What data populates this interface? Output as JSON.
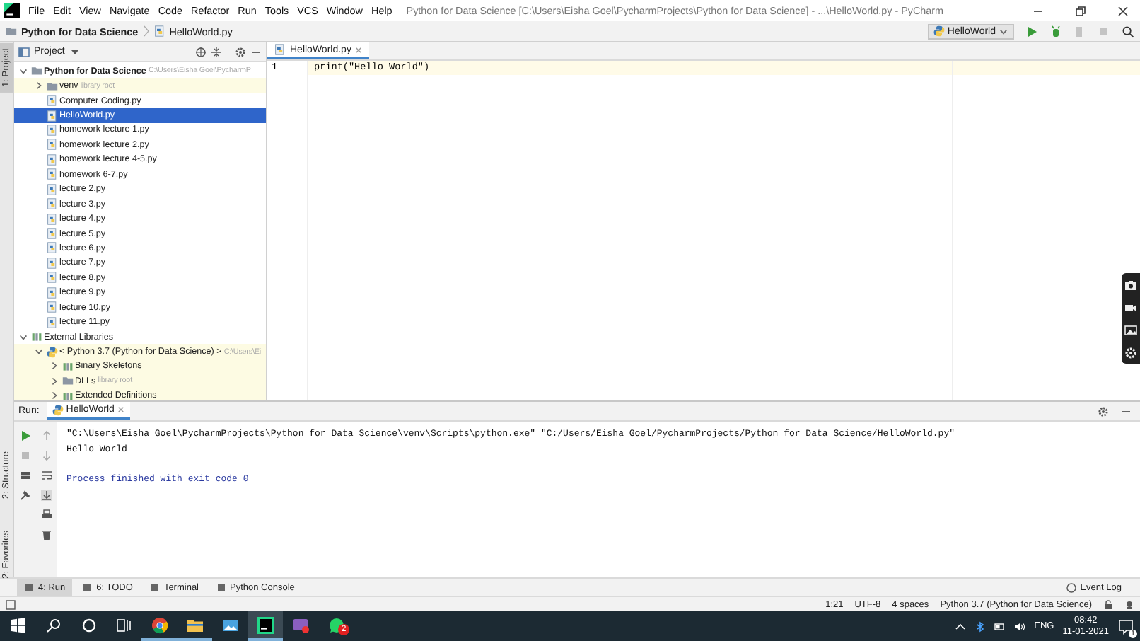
{
  "menu": [
    "File",
    "Edit",
    "View",
    "Navigate",
    "Code",
    "Refactor",
    "Run",
    "Tools",
    "VCS",
    "Window",
    "Help"
  ],
  "window": {
    "title": "Python for Data Science [C:\\Users\\Eisha Goel\\PycharmProjects\\Python for Data Science] - ...\\HelloWorld.py - PyCharm"
  },
  "breadcrumb": [
    "Python for Data Science",
    "HelloWorld.py"
  ],
  "run_config": {
    "label": "HelloWorld"
  },
  "side_tabs": [
    {
      "label": "1: Project",
      "selected": true
    },
    {
      "label": "2: Structure",
      "selected": false
    },
    {
      "label": "2: Favorites",
      "selected": false
    }
  ],
  "project_panel": {
    "title": "Project",
    "tree": [
      {
        "kind": "folder",
        "name": "Python for Data Science",
        "hint": "C:\\Users\\Eisha Goel\\PycharmP",
        "expanded": true,
        "tinted": false,
        "selected": false,
        "children": [
          {
            "kind": "folder",
            "name": "venv",
            "hint": "library root",
            "expanded": false,
            "tinted": true,
            "selected": false
          },
          {
            "kind": "file",
            "name": "Computer Coding.py",
            "tinted": false,
            "selected": false
          },
          {
            "kind": "file",
            "name": "HelloWorld.py",
            "tinted": false,
            "selected": true
          },
          {
            "kind": "file",
            "name": "homework lecture 1.py",
            "tinted": false,
            "selected": false
          },
          {
            "kind": "file",
            "name": "homework lecture 2.py",
            "tinted": false,
            "selected": false
          },
          {
            "kind": "file",
            "name": "homework lecture 4-5.py",
            "tinted": false,
            "selected": false
          },
          {
            "kind": "file",
            "name": "homework 6-7.py",
            "tinted": false,
            "selected": false
          },
          {
            "kind": "file",
            "name": "lecture 2.py",
            "tinted": false,
            "selected": false
          },
          {
            "kind": "file",
            "name": "lecture 3.py",
            "tinted": false,
            "selected": false
          },
          {
            "kind": "file",
            "name": "lecture 4.py",
            "tinted": false,
            "selected": false
          },
          {
            "kind": "file",
            "name": "lecture 5.py",
            "tinted": false,
            "selected": false
          },
          {
            "kind": "file",
            "name": "lecture 6.py",
            "tinted": false,
            "selected": false
          },
          {
            "kind": "file",
            "name": "lecture 7.py",
            "tinted": false,
            "selected": false
          },
          {
            "kind": "file",
            "name": "lecture 8.py",
            "tinted": false,
            "selected": false
          },
          {
            "kind": "file",
            "name": "lecture 9.py",
            "tinted": false,
            "selected": false
          },
          {
            "kind": "file",
            "name": "lecture 10.py",
            "tinted": false,
            "selected": false
          },
          {
            "kind": "file",
            "name": "lecture 11.py",
            "tinted": false,
            "selected": false
          }
        ]
      },
      {
        "kind": "library",
        "name": "External Libraries",
        "expanded": true,
        "tinted": false,
        "selected": false,
        "children": [
          {
            "kind": "python",
            "name": "< Python 3.7 (Python for Data Science) >",
            "hint": "C:\\Users\\Ei",
            "expanded": true,
            "tinted": true,
            "selected": false,
            "children": [
              {
                "kind": "library",
                "name": "Binary Skeletons",
                "expanded": false,
                "tinted": true,
                "selected": false
              },
              {
                "kind": "folder",
                "name": "DLLs",
                "hint": "library root",
                "expanded": false,
                "tinted": true,
                "selected": false
              },
              {
                "kind": "library",
                "name": "Extended Definitions",
                "expanded": false,
                "tinted": true,
                "selected": false
              }
            ]
          }
        ]
      }
    ]
  },
  "editor": {
    "tabs": [
      {
        "label": "HelloWorld.py",
        "selected": true
      }
    ],
    "lines": [
      {
        "number": "1",
        "code": "print(\"Hello World\")"
      }
    ]
  },
  "run_panel": {
    "label": "Run:",
    "tab": "HelloWorld",
    "output": [
      {
        "kind": "command",
        "text": "\"C:\\Users\\Eisha Goel\\PycharmProjects\\Python for Data Science\\venv\\Scripts\\python.exe\" \"C:/Users/Eisha Goel/PycharmProjects/Python for Data Science/HelloWorld.py\""
      },
      {
        "kind": "stdout",
        "text": "Hello World"
      },
      {
        "kind": "exit",
        "text": "Process finished with exit code 0"
      }
    ]
  },
  "tool_windows": [
    {
      "label": "4: Run",
      "selected": true
    },
    {
      "label": "6: TODO",
      "selected": false
    },
    {
      "label": "Terminal",
      "selected": false
    },
    {
      "label": "Python Console",
      "selected": false
    }
  ],
  "event_log": "Event Log",
  "status_bar": [
    "1:21",
    "UTF-8",
    "4 spaces",
    "Python 3.7 (Python for Data Science)"
  ],
  "taskbar": {
    "apps": [
      {
        "kind": "chrome",
        "selected": false,
        "running": true
      },
      {
        "kind": "explorer",
        "selected": false,
        "running": true
      },
      {
        "kind": "photos",
        "selected": false,
        "running": false
      },
      {
        "kind": "pycharm",
        "selected": true,
        "running": true
      },
      {
        "kind": "capture",
        "selected": false,
        "running": false
      },
      {
        "kind": "whatsapp",
        "selected": false,
        "running": false,
        "badge": "2"
      }
    ],
    "language": "ENG",
    "time": "08:42",
    "date": "11-01-2021",
    "notifications": "1"
  }
}
